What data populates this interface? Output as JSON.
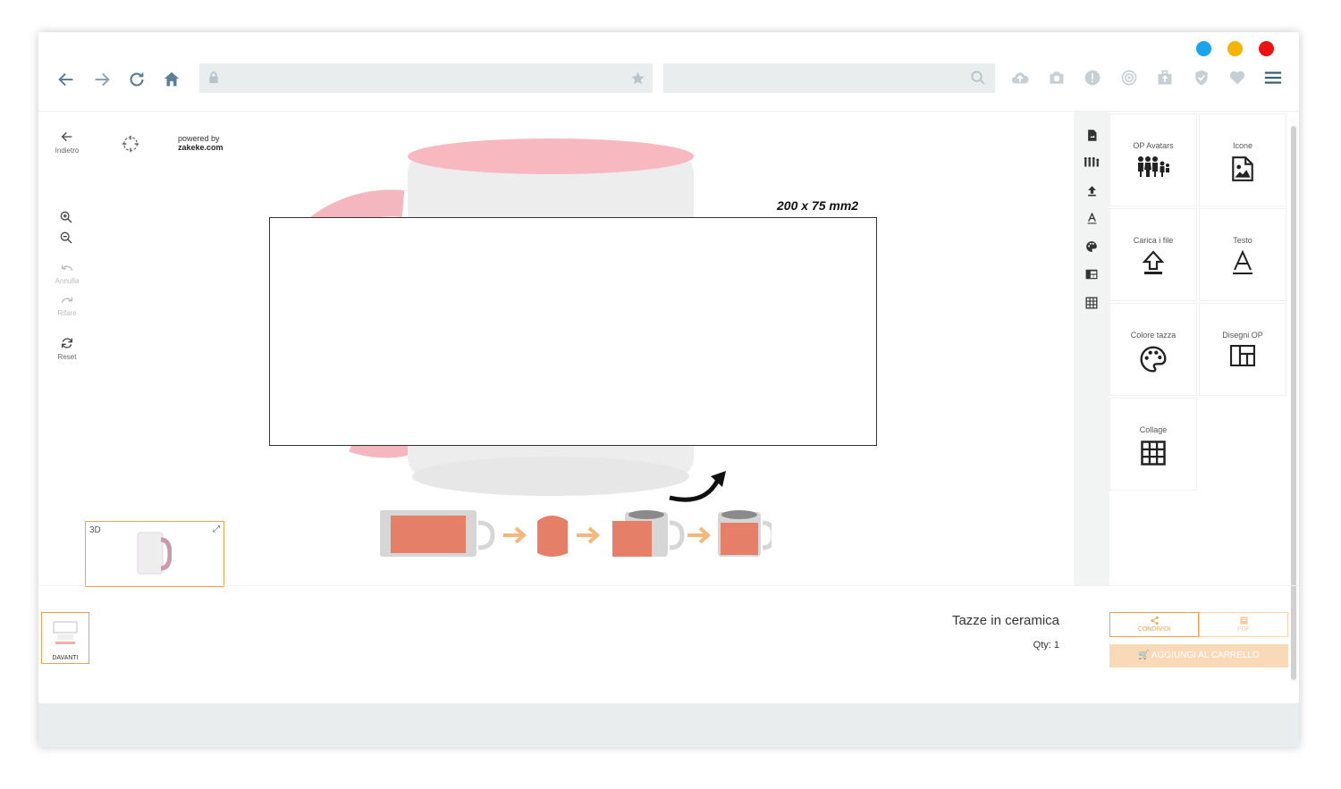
{
  "window": {
    "dot_colors": [
      "#1aa3ee",
      "#f5b400",
      "#ee1111"
    ]
  },
  "browser": {
    "url_value": "",
    "search_value": "",
    "icon_color": "#5b7f95"
  },
  "left_toolbar": {
    "back_label": "Indietro",
    "powered_by_line1": "powered by",
    "powered_by_line2": "zakeke.com",
    "undo_label": "Annulla",
    "redo_label": "Rifare",
    "reset_label": "Reset"
  },
  "canvas": {
    "print_area_label": "200 x 75 mm2",
    "thumb_3d_label": "3D",
    "mug_colors": {
      "handle": "#f4b6bf",
      "rim": "#f7b8c0",
      "body": "#ededed"
    },
    "step_color": "#e57f67",
    "arrow_color": "#f5b77a"
  },
  "panel": {
    "tiles": [
      {
        "label": "OP Avatars"
      },
      {
        "label": "Icone"
      },
      {
        "label": "Carica i file"
      },
      {
        "label": "Testo"
      },
      {
        "label": "Colore tazza"
      },
      {
        "label": "Disegni OP"
      },
      {
        "label": "Collage"
      }
    ]
  },
  "footer": {
    "side_label": "DAVANTI",
    "product_name": "Tazze in ceramica",
    "qty": "Qty: 1",
    "share_label": "CONDIVIDI",
    "pdf_label": "PDF",
    "cart_label": "AGGIUNGI AL CARRELLO",
    "accent_color": "#f0a04b"
  }
}
